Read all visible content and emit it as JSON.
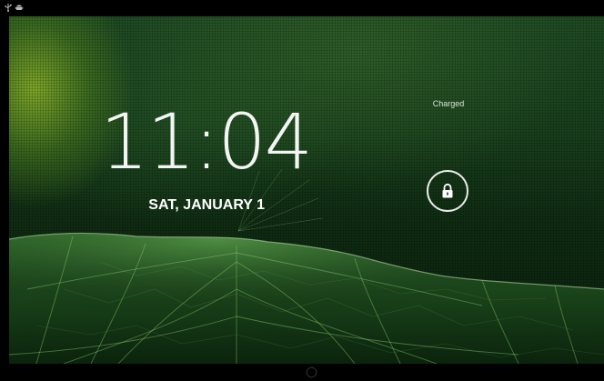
{
  "status_bar": {
    "icons": [
      "usb-icon",
      "android-icon"
    ]
  },
  "lockscreen": {
    "time": "11:04",
    "date": "SAT, JANUARY 1",
    "battery_status": "Charged",
    "unlock_icon": "lock-icon"
  },
  "nav_bar": {
    "home_icon": "home-icon"
  },
  "colors": {
    "text": "#ffffff",
    "leaf_vein": "#7fd06a",
    "background": "#000000"
  }
}
